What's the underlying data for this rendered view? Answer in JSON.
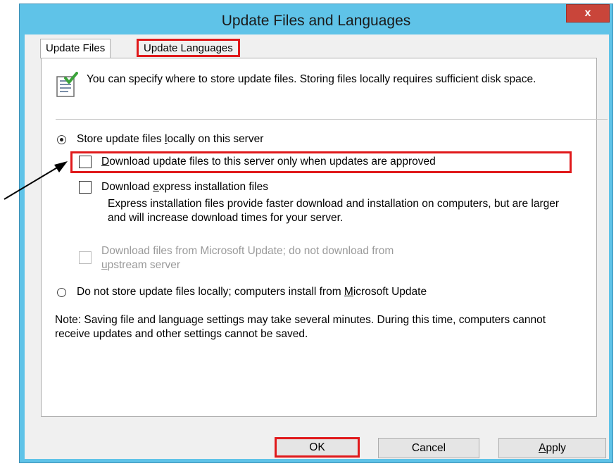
{
  "window": {
    "title": "Update Files and Languages",
    "close_glyph": "x"
  },
  "tabs": [
    {
      "label": "Update Files"
    },
    {
      "label": "Update Languages"
    }
  ],
  "info_text": "You can specify where to store update files. Storing files locally requires sufficient disk space.",
  "options": {
    "store_locally": {
      "pre": "Store update files ",
      "key": "l",
      "post": "ocally on this server",
      "selected": true
    },
    "download_approved": {
      "key": "D",
      "post": "ownload update files to this server only when updates are approved",
      "checked": false
    },
    "download_express": {
      "pre": "Download ",
      "key": "e",
      "post": "xpress installation files",
      "checked": false
    },
    "express_description": "Express installation files provide faster download and installation on computers, but are larger and will increase download times for your server.",
    "download_microsoft": {
      "line1": "Download files from Microsoft Update; do not download from",
      "key": "u",
      "line2_post": "pstream server",
      "checked": false,
      "disabled": true
    },
    "not_locally": {
      "pre": "Do not store update files locally; computers install from ",
      "key": "M",
      "post": "icrosoft Update",
      "selected": false
    }
  },
  "note": "Note: Saving file and language settings may take several minutes. During this time, computers cannot receive updates and other settings cannot be saved.",
  "buttons": {
    "ok": "OK",
    "cancel": "Cancel",
    "apply_key": "A",
    "apply_rest": "pply"
  },
  "colors": {
    "title_bar": "#5fc3e8",
    "close_button": "#c9453a",
    "highlight": "#e0191b"
  },
  "icons": {
    "info": "document-checkmark-icon"
  }
}
